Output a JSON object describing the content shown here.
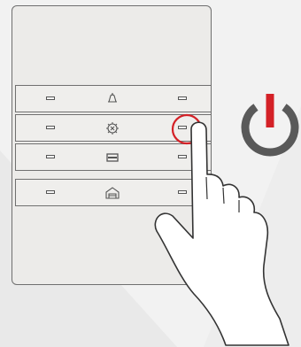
{
  "device": {
    "name": "wall-switch-panel",
    "keys": [
      {
        "id": "key-1",
        "icon": "bell-icon"
      },
      {
        "id": "key-2",
        "icon": "light-icon"
      },
      {
        "id": "key-3",
        "icon": "blind-icon"
      },
      {
        "id": "key-4",
        "icon": "garage-icon"
      }
    ],
    "active_key": "key-2",
    "active_indicator": "right-led"
  },
  "power_symbol": {
    "icon": "power-icon",
    "accent": "#d42127",
    "body": "#595959"
  },
  "hand": {
    "icon": "pointing-hand-icon"
  },
  "colors": {
    "background": "#f2f2f2",
    "panel": "#ecebe9",
    "outline": "#6f6f6f",
    "highlight_ring": "#d42127"
  }
}
